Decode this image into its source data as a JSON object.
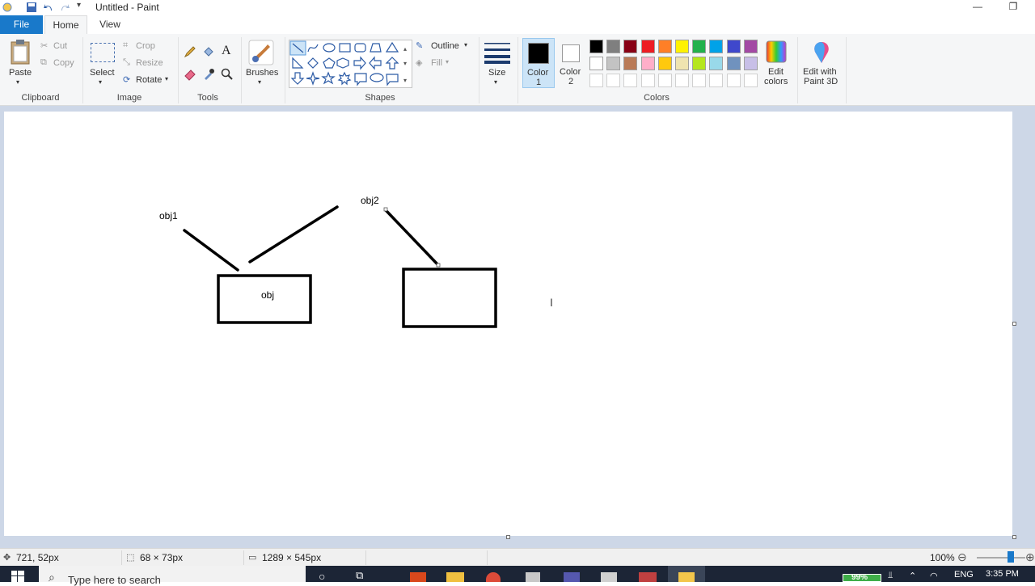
{
  "window": {
    "title": "Untitled - Paint"
  },
  "menu": {
    "file": "File",
    "home": "Home",
    "view": "View"
  },
  "ribbon": {
    "clipboard": {
      "paste": "Paste",
      "cut": "Cut",
      "copy": "Copy",
      "label": "Clipboard"
    },
    "image": {
      "select": "Select",
      "crop": "Crop",
      "resize": "Resize",
      "rotate": "Rotate",
      "label": "Image"
    },
    "tools": {
      "label": "Tools"
    },
    "brushes": {
      "label": "Brushes"
    },
    "shapes": {
      "outline": "Outline",
      "fill": "Fill",
      "label": "Shapes"
    },
    "size": {
      "label": "Size"
    },
    "color1": {
      "line1": "Color",
      "line2": "1"
    },
    "color2": {
      "line1": "Color",
      "line2": "2"
    },
    "colors": {
      "label": "Colors",
      "edit_line1": "Edit",
      "edit_line2": "colors",
      "row1": [
        "#000000",
        "#7f7f7f",
        "#880015",
        "#ed1c24",
        "#ff7f27",
        "#fff200",
        "#22b14c",
        "#00a2e8",
        "#3f48cc",
        "#a349a4"
      ],
      "row2": [
        "#ffffff",
        "#c3c3c3",
        "#b97a57",
        "#ffaec9",
        "#ffc90e",
        "#efe4b0",
        "#b5e61d",
        "#99d9ea",
        "#7092be",
        "#c8bfe7"
      ]
    },
    "paint3d": {
      "line1": "Edit with",
      "line2": "Paint 3D"
    }
  },
  "canvas": {
    "labels": {
      "obj1": "obj1",
      "obj2": "obj2",
      "obj": "obj"
    }
  },
  "status": {
    "cursor_pos": "721, 52px",
    "selection_size": "68 × 73px",
    "image_size": "1289 × 545px",
    "zoom": "100%"
  },
  "taskbar": {
    "search_placeholder": "Type here to search",
    "battery": "99%",
    "lang": "ENG",
    "time": "3:35 PM"
  }
}
